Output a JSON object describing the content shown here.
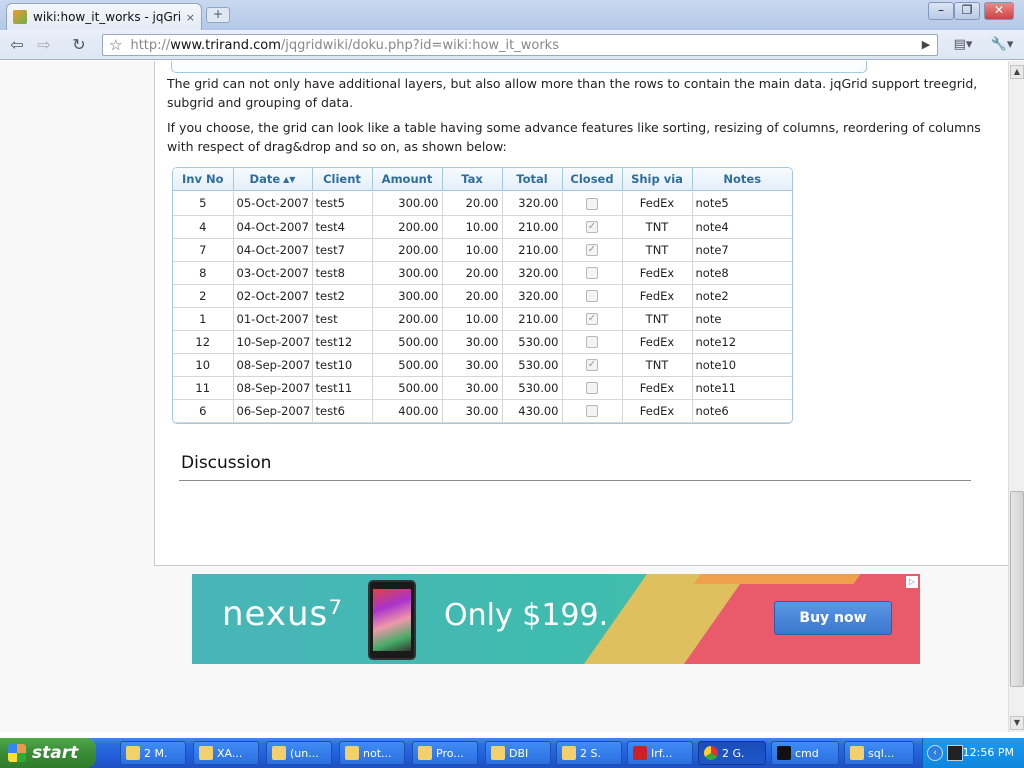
{
  "browser": {
    "tab_title": "wiki:how_it_works - jqGrid ...",
    "tab_close": "×",
    "new_tab": "+",
    "url_prefix": "http://",
    "url_domain": "www.trirand.com",
    "url_path": "/jqgridwiki/doku.php?id=wiki:how_it_works",
    "win_minimize": "–",
    "win_maximize": "❐",
    "win_close": "✕",
    "back": "⇦",
    "forward": "⇨",
    "reload": "↻",
    "bookmark_star": "☆",
    "go": "▶",
    "page_menu": "▤▾",
    "tools_menu": "🔧▾"
  },
  "page": {
    "paragraph1": "The grid can not only have additional layers, but also allow more than the rows to contain the main data. jqGrid support treegrid, subgrid and grouping of data.",
    "paragraph2": "If you choose, the grid can look like a table having some advance features like sorting, resizing of columns, reordering of columns with respect of drag&drop and so on, as shown below:",
    "discussion_heading": "Discussion"
  },
  "grid": {
    "columns": [
      "Inv No",
      "Date",
      "Client",
      "Amount",
      "Tax",
      "Total",
      "Closed",
      "Ship via",
      "Notes"
    ],
    "sort_indicator": "▲▼",
    "rows": [
      {
        "inv": "5",
        "date": "05-Oct-2007",
        "client": "test5",
        "amount": "300.00",
        "tax": "20.00",
        "total": "320.00",
        "closed": false,
        "ship": "FedEx",
        "notes": "note5"
      },
      {
        "inv": "4",
        "date": "04-Oct-2007",
        "client": "test4",
        "amount": "200.00",
        "tax": "10.00",
        "total": "210.00",
        "closed": true,
        "ship": "TNT",
        "notes": "note4"
      },
      {
        "inv": "7",
        "date": "04-Oct-2007",
        "client": "test7",
        "amount": "200.00",
        "tax": "10.00",
        "total": "210.00",
        "closed": true,
        "ship": "TNT",
        "notes": "note7"
      },
      {
        "inv": "8",
        "date": "03-Oct-2007",
        "client": "test8",
        "amount": "300.00",
        "tax": "20.00",
        "total": "320.00",
        "closed": false,
        "ship": "FedEx",
        "notes": "note8"
      },
      {
        "inv": "2",
        "date": "02-Oct-2007",
        "client": "test2",
        "amount": "300.00",
        "tax": "20.00",
        "total": "320.00",
        "closed": false,
        "ship": "FedEx",
        "notes": "note2"
      },
      {
        "inv": "1",
        "date": "01-Oct-2007",
        "client": "test",
        "amount": "200.00",
        "tax": "10.00",
        "total": "210.00",
        "closed": true,
        "ship": "TNT",
        "notes": "note"
      },
      {
        "inv": "12",
        "date": "10-Sep-2007",
        "client": "test12",
        "amount": "500.00",
        "tax": "30.00",
        "total": "530.00",
        "closed": false,
        "ship": "FedEx",
        "notes": "note12"
      },
      {
        "inv": "10",
        "date": "08-Sep-2007",
        "client": "test10",
        "amount": "500.00",
        "tax": "30.00",
        "total": "530.00",
        "closed": true,
        "ship": "TNT",
        "notes": "note10"
      },
      {
        "inv": "11",
        "date": "08-Sep-2007",
        "client": "test11",
        "amount": "500.00",
        "tax": "30.00",
        "total": "530.00",
        "closed": false,
        "ship": "FedEx",
        "notes": "note11"
      },
      {
        "inv": "6",
        "date": "06-Sep-2007",
        "client": "test6",
        "amount": "400.00",
        "tax": "30.00",
        "total": "430.00",
        "closed": false,
        "ship": "FedEx",
        "notes": "note6"
      }
    ],
    "check_mark": "✓"
  },
  "ad": {
    "brand": "nexus⁷",
    "price_text": "Only $199.",
    "button": "Buy now",
    "choices_icon": "▷"
  },
  "scrollbar": {
    "up": "▲",
    "down": "▼"
  },
  "taskbar": {
    "start_label": "start",
    "tasks": [
      "2 M.",
      "XA...",
      "(un...",
      "not...",
      "Pro...",
      "DBI",
      "2 S.",
      "Irf...",
      "2 G.",
      "cmd",
      "sql..."
    ],
    "clock": "12:56 PM",
    "tray_arrow": "‹"
  },
  "colors": {
    "grid_header_text": "#2e6e9e",
    "grid_border": "#a6c9e2",
    "taskbar": "#245edb",
    "start_button": "#3a8c36"
  }
}
